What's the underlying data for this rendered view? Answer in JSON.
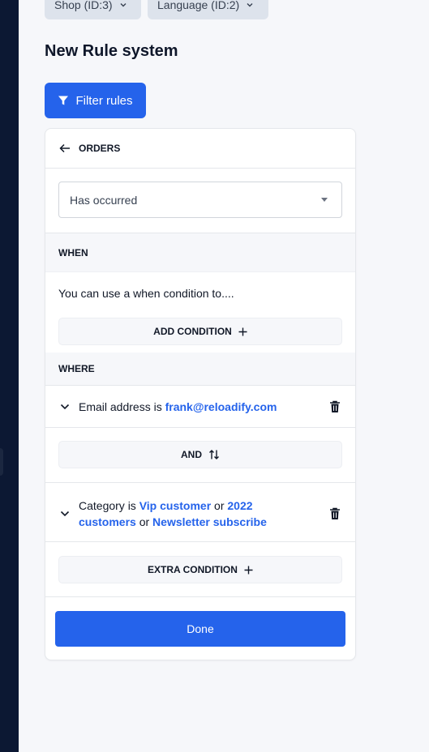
{
  "filters": {
    "shop_label": "Shop (ID:3)",
    "language_label": "Language (ID:2)"
  },
  "page": {
    "title": "New Rule system"
  },
  "toolbar": {
    "filter_rules_label": "Filter rules"
  },
  "panel": {
    "header_label": "ORDERS",
    "select_value": "Has occurred",
    "when": {
      "label": "WHEN",
      "description": "You can use a when condition to....",
      "add_condition_label": "ADD CONDITION"
    },
    "where": {
      "label": "WHERE",
      "condition1": {
        "field": "Email address is",
        "value": "frank@reloadify.com"
      },
      "and_label": "AND",
      "condition2": {
        "field": "Category is",
        "value1": "Vip customer",
        "or1": "or",
        "value2": "2022 customers",
        "or2": "or",
        "value3": "Newsletter subscribe"
      },
      "extra_condition_label": "EXTRA CONDITION"
    },
    "done_label": "Done"
  },
  "colors": {
    "accent": "#2563eb",
    "sidebar": "#0c1833",
    "background": "#f6f7fa"
  }
}
